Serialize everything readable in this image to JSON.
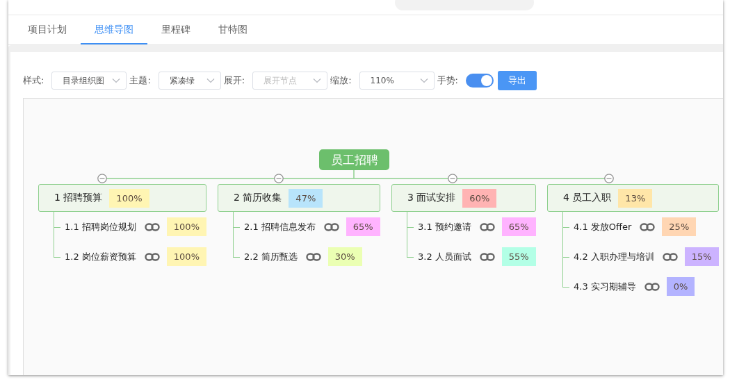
{
  "tabs": [
    {
      "label": "项目计划",
      "selected": false
    },
    {
      "label": "思维导图",
      "selected": true
    },
    {
      "label": "里程碑",
      "selected": false
    },
    {
      "label": "甘特图",
      "selected": false
    }
  ],
  "toolbar": {
    "controls": [
      {
        "kind": "select",
        "label": "样式:",
        "value": "目录组织图"
      },
      {
        "kind": "select",
        "label": "主题:",
        "value": "紧凑绿"
      },
      {
        "kind": "select",
        "label": "展开:",
        "placeholder": "展开节点"
      },
      {
        "kind": "select",
        "label": "缩放:",
        "value": "110%"
      },
      {
        "kind": "toggle",
        "label": "手势:",
        "on": true
      }
    ],
    "export_button": "导出"
  },
  "mindmap": {
    "root": "员工招聘",
    "branches": [
      {
        "title": "1 招聘预算",
        "progress": "100%",
        "color": "#fff5b3",
        "collapsed": false,
        "children": [
          {
            "title": "1.1 招聘岗位规划",
            "progress": "100%",
            "color": "#fff5b3"
          },
          {
            "title": "1.2 岗位薪资预算",
            "progress": "100%",
            "color": "#fff5b3"
          }
        ]
      },
      {
        "title": "2 简历收集",
        "progress": "47%",
        "color": "#b8e4fb",
        "collapsed": false,
        "children": [
          {
            "title": "2.1 招聘信息发布",
            "progress": "65%",
            "color": "#ffb3ff"
          },
          {
            "title": "2.2 简历甄选",
            "progress": "30%",
            "color": "#ebffb3"
          }
        ]
      },
      {
        "title": "3 面试安排",
        "progress": "60%",
        "color": "#ffb3b3",
        "collapsed": false,
        "children": [
          {
            "title": "3.1 预约邀请",
            "progress": "65%",
            "color": "#ffb3ff"
          },
          {
            "title": "3.2 人员面试",
            "progress": "55%",
            "color": "#b3ffe6"
          }
        ]
      },
      {
        "title": "4 员工入职",
        "progress": "13%",
        "color": "#ffe6a8",
        "collapsed": false,
        "children": [
          {
            "title": "4.1 发放Offer",
            "progress": "25%",
            "color": "#ffd6b3"
          },
          {
            "title": "4.2 入职办理与培训",
            "progress": "15%",
            "color": "#ccb3ff"
          },
          {
            "title": "4.3 实习期辅导",
            "progress": "0%",
            "color": "#b3b3ff"
          }
        ]
      }
    ]
  }
}
